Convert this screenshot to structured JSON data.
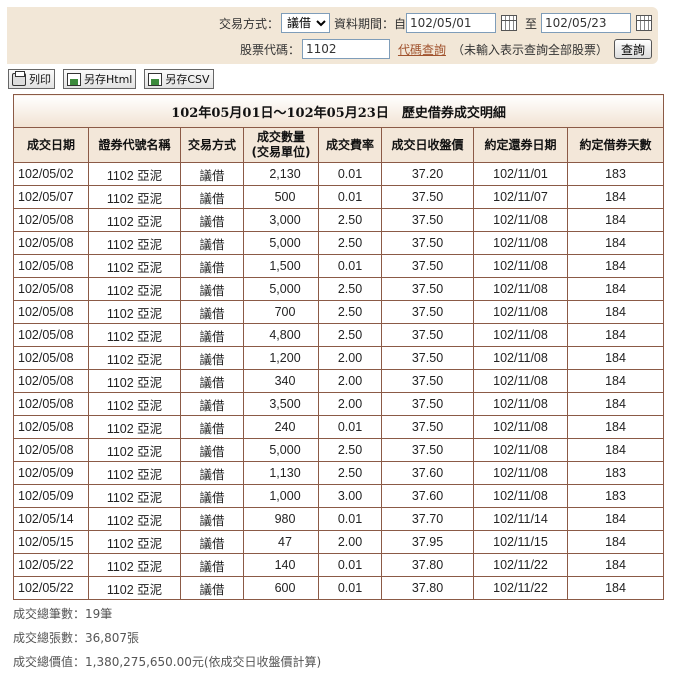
{
  "filters": {
    "trade_type_label": "交易方式：",
    "trade_type_value": "議借",
    "period_label": "資料期間：自",
    "start_date": "102/05/01",
    "to_label": "至",
    "end_date": "102/05/23",
    "stock_code_label": "股票代碼：",
    "stock_code": "1102",
    "code_lookup_link": "代碼查詢",
    "hint": "（未輸入表示查詢全部股票）",
    "query_button": "查詢"
  },
  "toolbar": {
    "print_label": "列印",
    "save_html_label": "另存Html",
    "save_csv_label": "另存CSV"
  },
  "report": {
    "title": "102年05月01日～102年05月23日　歷史借券成交明細",
    "columns": [
      "成交日期",
      "證券代號名稱",
      "交易方式",
      "成交數量\n(交易單位)",
      "成交費率",
      "成交日收盤價",
      "約定還券日期",
      "約定借券天數"
    ],
    "rows": [
      [
        "102/05/02",
        "1102 亞泥",
        "議借",
        "2,130",
        "0.01",
        "37.20",
        "102/11/01",
        "183"
      ],
      [
        "102/05/07",
        "1102 亞泥",
        "議借",
        "500",
        "0.01",
        "37.50",
        "102/11/07",
        "184"
      ],
      [
        "102/05/08",
        "1102 亞泥",
        "議借",
        "3,000",
        "2.50",
        "37.50",
        "102/11/08",
        "184"
      ],
      [
        "102/05/08",
        "1102 亞泥",
        "議借",
        "5,000",
        "2.50",
        "37.50",
        "102/11/08",
        "184"
      ],
      [
        "102/05/08",
        "1102 亞泥",
        "議借",
        "1,500",
        "0.01",
        "37.50",
        "102/11/08",
        "184"
      ],
      [
        "102/05/08",
        "1102 亞泥",
        "議借",
        "5,000",
        "2.50",
        "37.50",
        "102/11/08",
        "184"
      ],
      [
        "102/05/08",
        "1102 亞泥",
        "議借",
        "700",
        "2.50",
        "37.50",
        "102/11/08",
        "184"
      ],
      [
        "102/05/08",
        "1102 亞泥",
        "議借",
        "4,800",
        "2.50",
        "37.50",
        "102/11/08",
        "184"
      ],
      [
        "102/05/08",
        "1102 亞泥",
        "議借",
        "1,200",
        "2.00",
        "37.50",
        "102/11/08",
        "184"
      ],
      [
        "102/05/08",
        "1102 亞泥",
        "議借",
        "340",
        "2.00",
        "37.50",
        "102/11/08",
        "184"
      ],
      [
        "102/05/08",
        "1102 亞泥",
        "議借",
        "3,500",
        "2.00",
        "37.50",
        "102/11/08",
        "184"
      ],
      [
        "102/05/08",
        "1102 亞泥",
        "議借",
        "240",
        "0.01",
        "37.50",
        "102/11/08",
        "184"
      ],
      [
        "102/05/08",
        "1102 亞泥",
        "議借",
        "5,000",
        "2.50",
        "37.50",
        "102/11/08",
        "184"
      ],
      [
        "102/05/09",
        "1102 亞泥",
        "議借",
        "1,130",
        "2.50",
        "37.60",
        "102/11/08",
        "183"
      ],
      [
        "102/05/09",
        "1102 亞泥",
        "議借",
        "1,000",
        "3.00",
        "37.60",
        "102/11/08",
        "183"
      ],
      [
        "102/05/14",
        "1102 亞泥",
        "議借",
        "980",
        "0.01",
        "37.70",
        "102/11/14",
        "184"
      ],
      [
        "102/05/15",
        "1102 亞泥",
        "議借",
        "47",
        "2.00",
        "37.95",
        "102/11/15",
        "184"
      ],
      [
        "102/05/22",
        "1102 亞泥",
        "議借",
        "140",
        "0.01",
        "37.80",
        "102/11/22",
        "184"
      ],
      [
        "102/05/22",
        "1102 亞泥",
        "議借",
        "600",
        "0.01",
        "37.80",
        "102/11/22",
        "184"
      ]
    ]
  },
  "summary": {
    "count": "成交總筆數：19筆",
    "shares": "成交總張數：36,807張",
    "value": "成交總價值：1,380,275,650.00元(依成交日收盤價計算)"
  }
}
